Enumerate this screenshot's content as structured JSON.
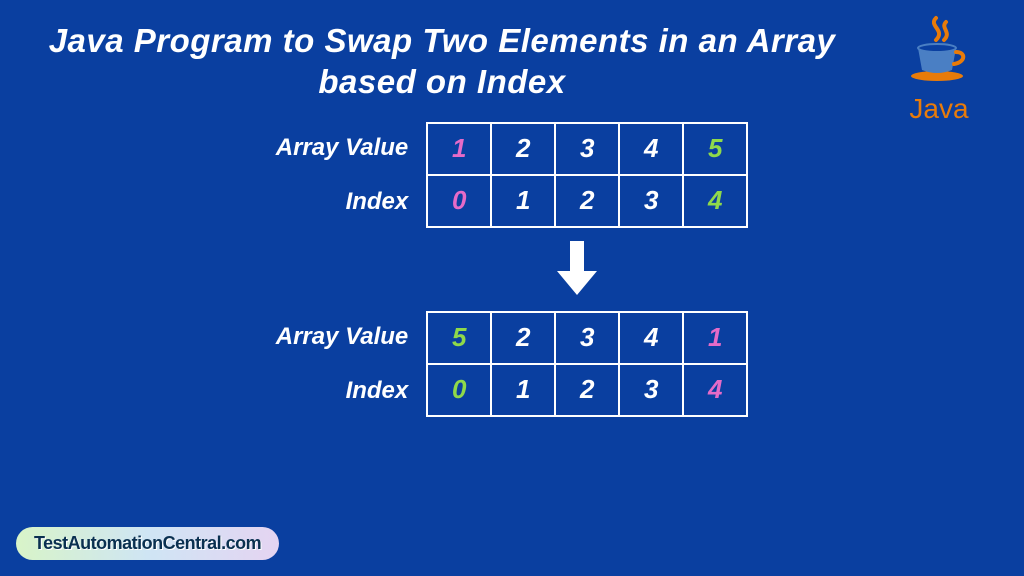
{
  "title": "Java Program to Swap Two Elements in an Array based on Index",
  "logo_text": "Java",
  "labels": {
    "value": "Array Value",
    "index": "Index"
  },
  "before": {
    "values": [
      {
        "v": "1",
        "cls": "c-magenta"
      },
      {
        "v": "2",
        "cls": ""
      },
      {
        "v": "3",
        "cls": ""
      },
      {
        "v": "4",
        "cls": ""
      },
      {
        "v": "5",
        "cls": "c-green"
      }
    ],
    "indices": [
      {
        "v": "0",
        "cls": "c-magenta"
      },
      {
        "v": "1",
        "cls": ""
      },
      {
        "v": "2",
        "cls": ""
      },
      {
        "v": "3",
        "cls": ""
      },
      {
        "v": "4",
        "cls": "c-green"
      }
    ]
  },
  "after": {
    "values": [
      {
        "v": "5",
        "cls": "c-green"
      },
      {
        "v": "2",
        "cls": ""
      },
      {
        "v": "3",
        "cls": ""
      },
      {
        "v": "4",
        "cls": ""
      },
      {
        "v": "1",
        "cls": "c-magenta"
      }
    ],
    "indices": [
      {
        "v": "0",
        "cls": "c-green"
      },
      {
        "v": "1",
        "cls": ""
      },
      {
        "v": "2",
        "cls": ""
      },
      {
        "v": "3",
        "cls": ""
      },
      {
        "v": "4",
        "cls": "c-magenta"
      }
    ]
  },
  "watermark": "TestAutomationCentral.com"
}
